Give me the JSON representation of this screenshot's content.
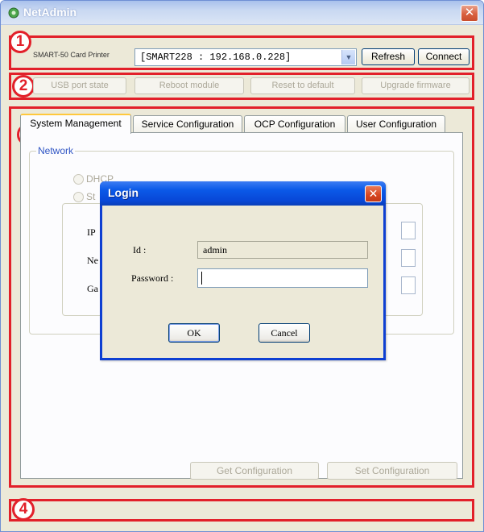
{
  "window": {
    "title": "NetAdmin",
    "close_glyph": "✕"
  },
  "markers": [
    "1",
    "2",
    "3",
    "4"
  ],
  "top_bar": {
    "printer_label": "SMART-50 Card Printer",
    "selected_device": "[SMART228 : 192.168.0.228]",
    "refresh_label": "Refresh",
    "connect_label": "Connect"
  },
  "actions": {
    "usb_port_state": "USB port state",
    "reboot_module": "Reboot module",
    "reset_default": "Reset to default",
    "upgrade_firmware": "Upgrade firmware"
  },
  "tabs": [
    {
      "label": "System Management"
    },
    {
      "label": "Service Configuration"
    },
    {
      "label": "OCP Configuration"
    },
    {
      "label": "User Configuration"
    }
  ],
  "network": {
    "group_label": "Network",
    "dhcp_label": "DHCP",
    "static_label": "St",
    "ip_label": "IP",
    "netmask_label": "Ne",
    "gateway_label": "Ga"
  },
  "footer_buttons": {
    "get_config": "Get Configuration",
    "set_config": "Set Configuration"
  },
  "login": {
    "title": "Login",
    "close_glyph": "✕",
    "id_label": "Id :",
    "id_value": "admin",
    "password_label": "Password :",
    "password_value": "",
    "ok_label": "OK",
    "cancel_label": "Cancel"
  },
  "colors": {
    "annotation_red": "#e2202a",
    "dialog_blue": "#0b5ae8",
    "window_bg": "#ece9d8"
  }
}
